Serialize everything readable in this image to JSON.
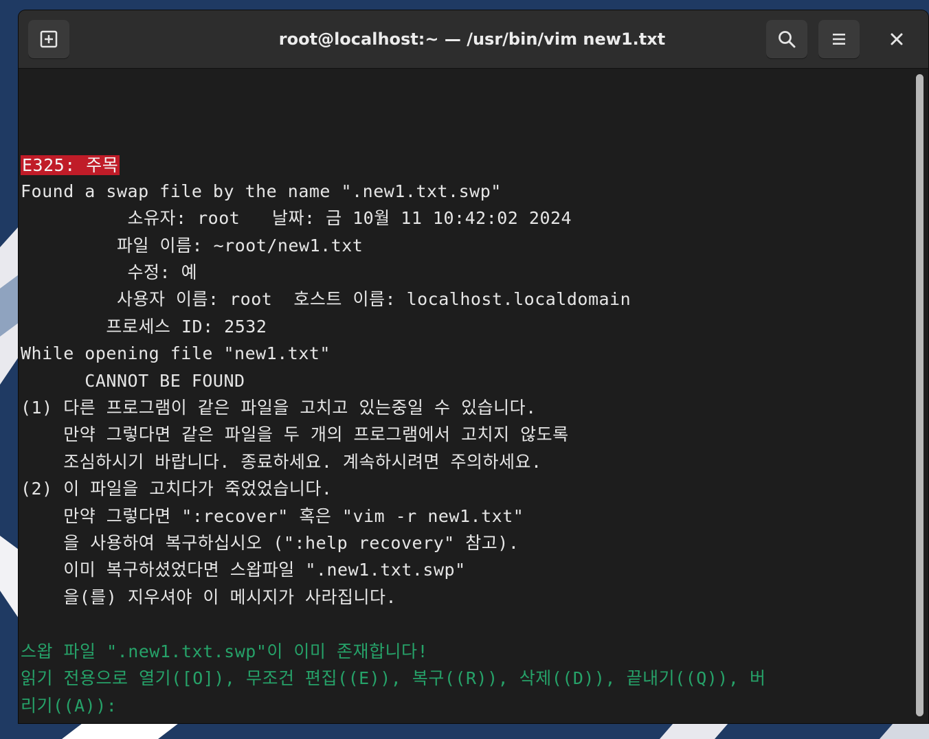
{
  "window": {
    "title": "root@localhost:~ — /usr/bin/vim new1.txt",
    "icons": {
      "new_tab": "new-tab-icon",
      "search": "search-icon",
      "menu": "hamburger-menu-icon",
      "close": "close-icon"
    }
  },
  "terminal": {
    "error_code": "E325: 주목",
    "lines": [
      "Found a swap file by the name \".new1.txt.swp\"",
      "          소유자: root   날짜: 금 10월 11 10:42:02 2024",
      "         파일 이름: ~root/new1.txt",
      "          수정: 예",
      "         사용자 이름: root  호스트 이름: localhost.localdomain",
      "        프로세스 ID: 2532",
      "While opening file \"new1.txt\"",
      "      CANNOT BE FOUND",
      "(1) 다른 프로그램이 같은 파일을 고치고 있는중일 수 있습니다.",
      "    만약 그렇다면 같은 파일을 두 개의 프로그램에서 고치지 않도록",
      "    조심하시기 바랍니다. 종료하세요. 계속하시려면 주의하세요.",
      "(2) 이 파일을 고치다가 죽었었습니다.",
      "    만약 그렇다면 \":recover\" 혹은 \"vim -r new1.txt\"",
      "    을 사용하여 복구하십시오 (\":help recovery\" 참고).",
      "    이미 복구하셨었다면 스왑파일 \".new1.txt.swp\"",
      "    을(를) 지우셔야 이 메시지가 사라집니다."
    ],
    "prompt_lines": [
      "스왑 파일 \".new1.txt.swp\"이 이미 존재합니다!",
      "읽기 전용으로 열기([O]), 무조건 편집((E)), 복구((R)), 삭제((D)), 끝내기((Q)), 버",
      "리기((A)):"
    ]
  },
  "colors": {
    "error_bg": "#c01c28",
    "prompt_green": "#26a269",
    "terminal_bg": "#1d1d1d",
    "titlebar_bg": "#2d2d2d"
  }
}
